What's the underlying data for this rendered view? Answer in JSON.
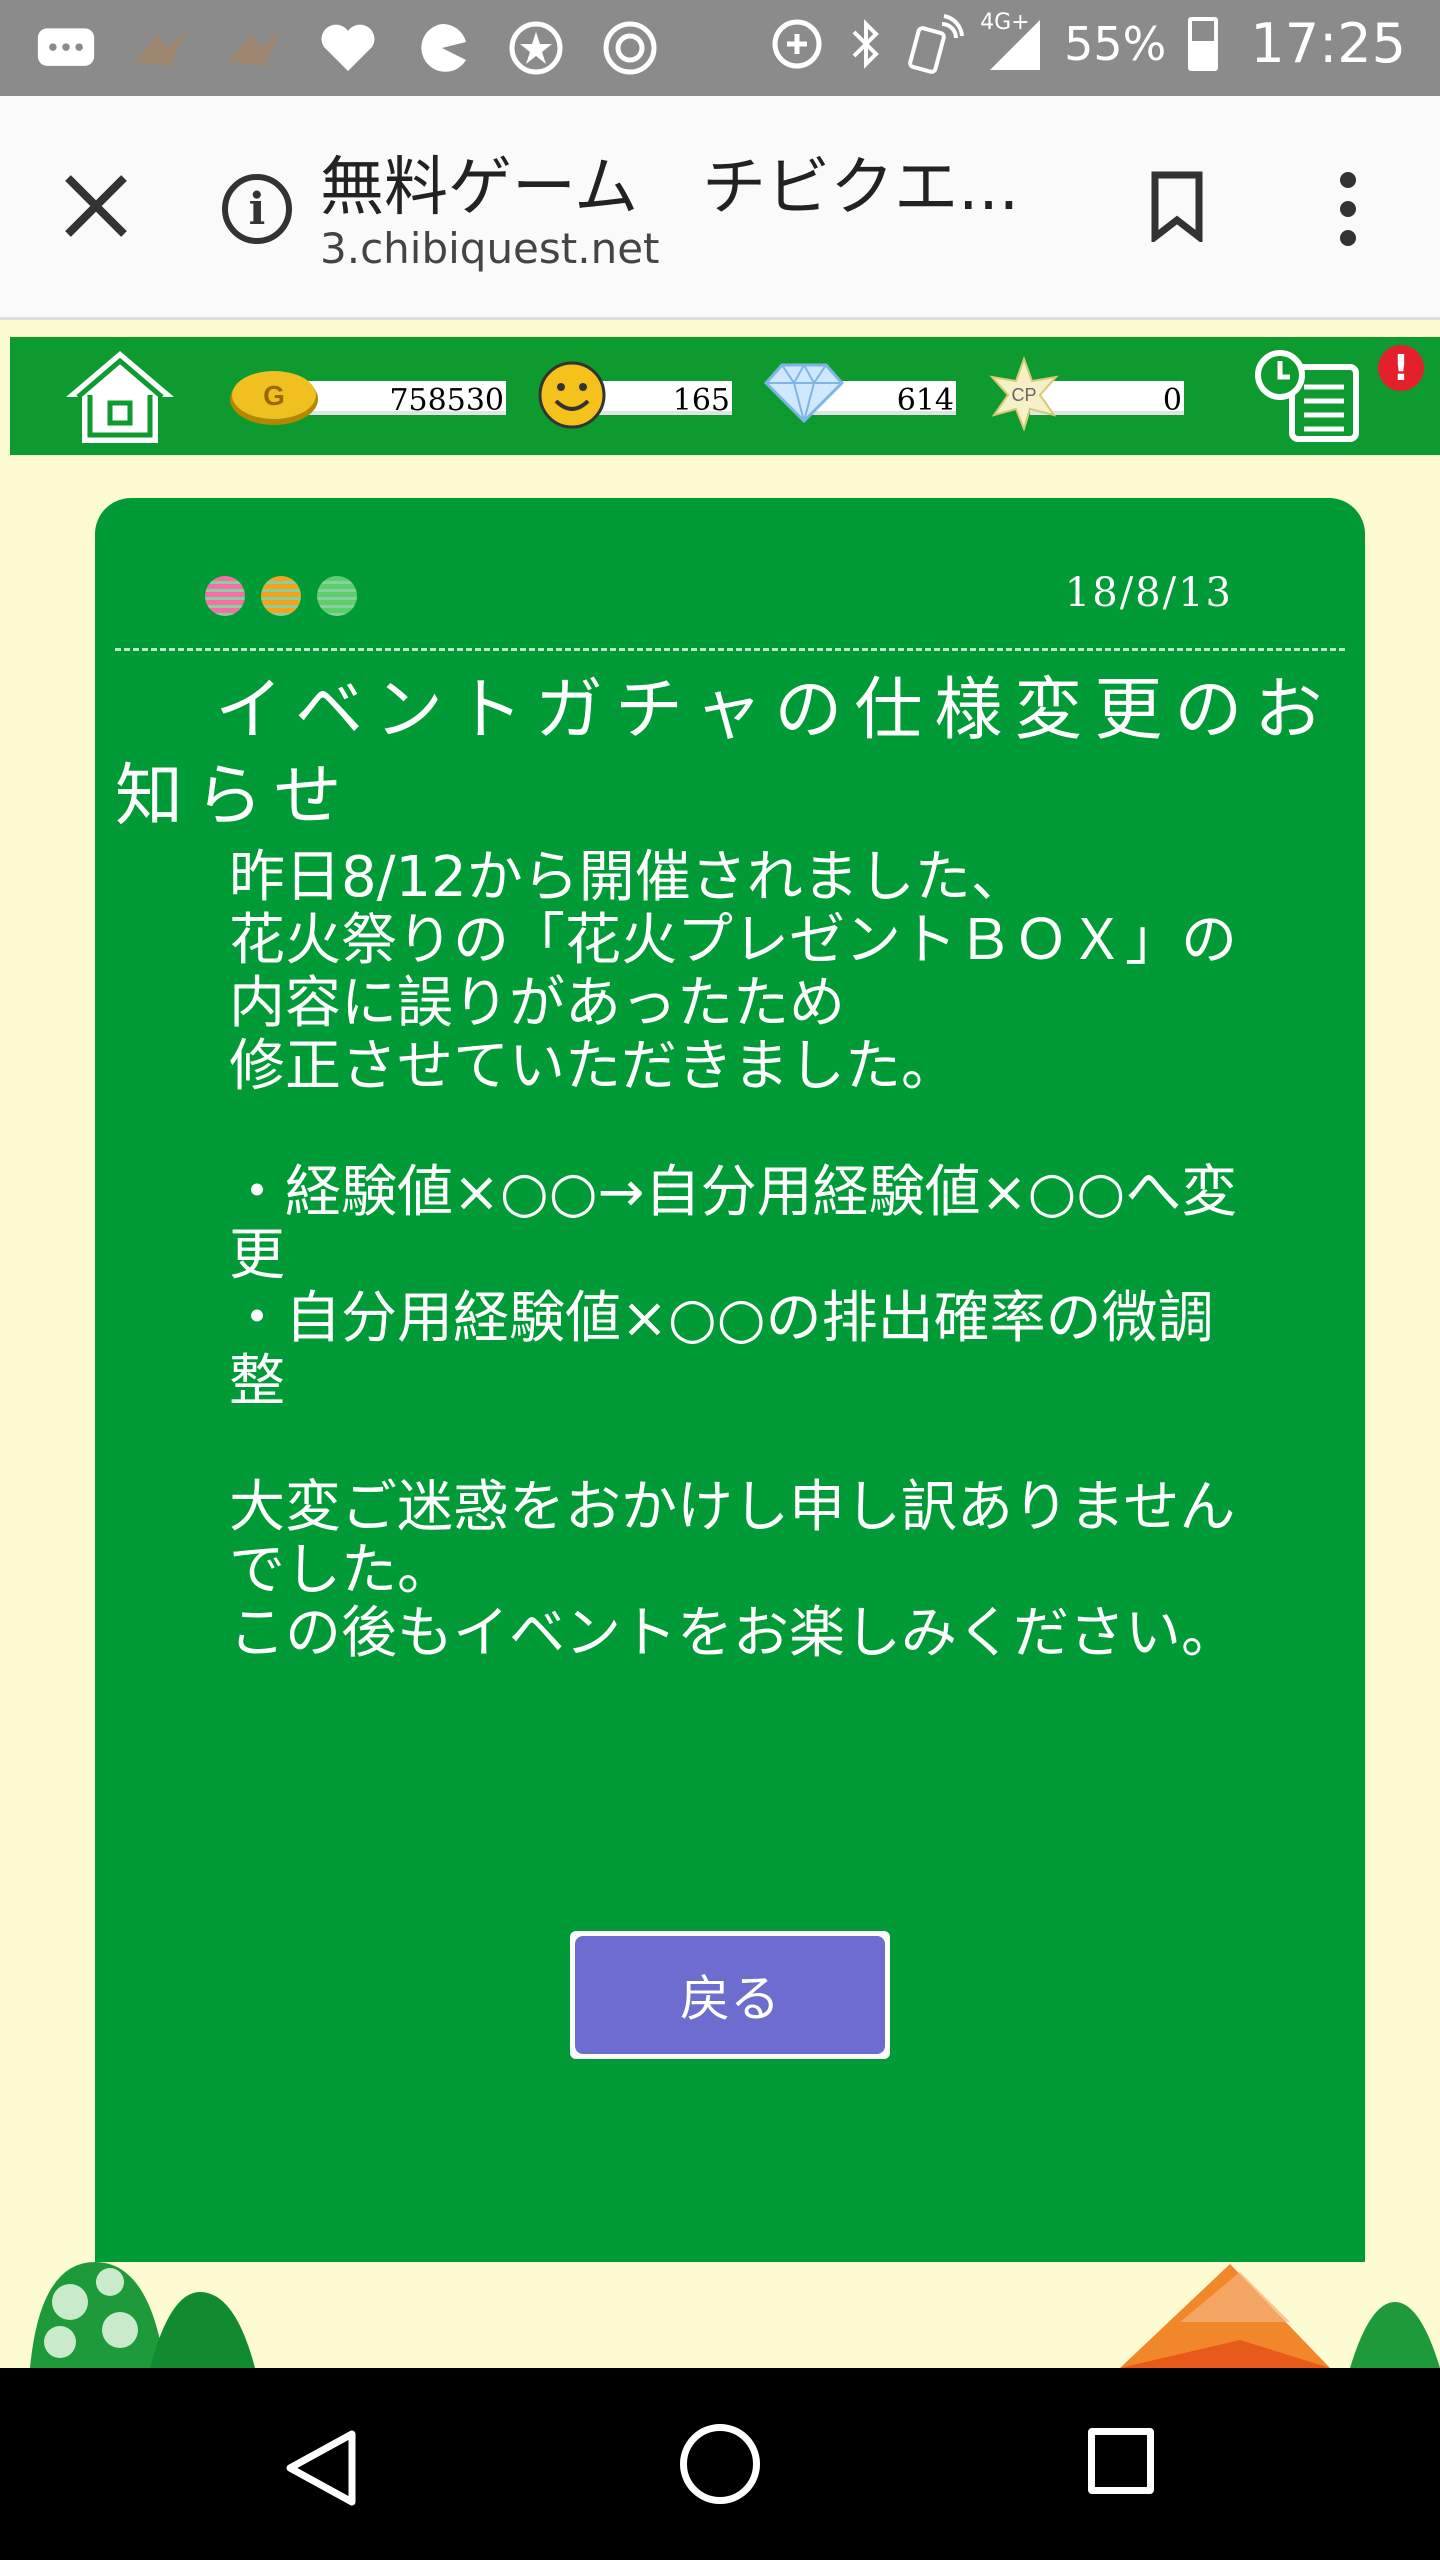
{
  "status_bar": {
    "battery_text": "55%",
    "network_text": "4G+",
    "time": "17:25",
    "icons": [
      "message-icon",
      "bird-icon",
      "bird-icon",
      "heart-icon",
      "pacman-icon",
      "star-badge-icon",
      "game-icon",
      "data-saver-icon",
      "bluetooth-icon",
      "nfc-phone-icon",
      "signal-icon",
      "battery-icon"
    ]
  },
  "browser": {
    "title": "無料ゲーム　チビクエ...",
    "url": "3.chibiquest.net"
  },
  "game_header": {
    "gold": "758530",
    "smile": "165",
    "diamond": "614",
    "cp": "0",
    "cp_badge": "CP",
    "gold_badge": "G",
    "alert_mark": "!"
  },
  "notice": {
    "date": "18/8/13",
    "title": "イベントガチャの仕様変更のお知らせ",
    "body": "昨日8/12から開催されました、\n花火祭りの「花火プレゼントＢＯＸ」の内容に誤りがあったため\n修正させていただきました。\n\n・経験値×○○→自分用経験値×○○へ変更\n・自分用経験値×○○の排出確率の微調整\n\n大変ご迷惑をおかけし申し訳ありませんでした。\nこの後もイベントをお楽しみください。",
    "back_label": "戻る"
  },
  "colors": {
    "panel_green": "#009a36",
    "header_green": "#0d9a2e",
    "button_purple": "#6d6ccf",
    "page_bg": "#fdfbd2"
  }
}
